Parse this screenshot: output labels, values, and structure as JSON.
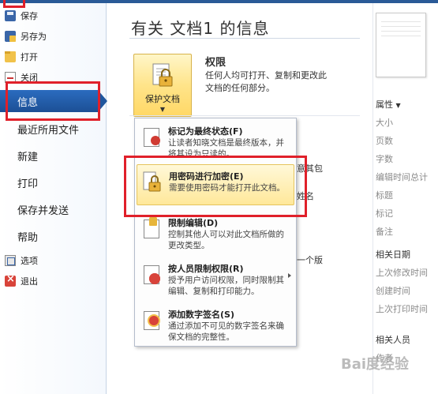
{
  "nav": {
    "save": "保存",
    "save_as": "另存为",
    "open": "打开",
    "close": "关闭",
    "info": "信息",
    "recent": "最近所用文件",
    "new": "新建",
    "print": "打印",
    "save_send": "保存并发送",
    "help": "帮助",
    "options": "选项",
    "exit": "退出"
  },
  "main": {
    "title": "有关 文档1 的信息",
    "protect_button": "保护文档",
    "permissions_title": "权限",
    "permissions_desc": "任何人均可打开、复制和更改此文档的任何部分。",
    "behind_text_1": "意其包",
    "behind_text_2": "姓名",
    "behind_text_3": "一个版"
  },
  "menu": {
    "items": [
      {
        "title": "标记为最终状态(F)",
        "desc": "让读者知晓文档是最终版本，并将其设为只读的。"
      },
      {
        "title": "用密码进行加密(E)",
        "desc": "需要使用密码才能打开此文档。"
      },
      {
        "title": "限制编辑(D)",
        "desc": "控制其他人可以对此文档所做的更改类型。"
      },
      {
        "title": "按人员限制权限(R)",
        "desc": "授予用户访问权限，同时限制其编辑、复制和打印能力。"
      },
      {
        "title": "添加数字签名(S)",
        "desc": "通过添加不可见的数字签名来确保文档的完整性。"
      }
    ]
  },
  "properties": {
    "header": "属性",
    "items": [
      "大小",
      "页数",
      "字数",
      "编辑时间总计",
      "标题",
      "标记",
      "备注"
    ],
    "related_dates": "相关日期",
    "dates": [
      "上次修改时间",
      "创建时间",
      "上次打印时间"
    ],
    "related_people": "相关人员",
    "people": [
      "作者"
    ]
  },
  "watermark": "Bai度经验",
  "colors": {
    "nav_selected": "#1f569e",
    "menu_hover": "#ffe89a",
    "annotation": "#e0202a"
  }
}
